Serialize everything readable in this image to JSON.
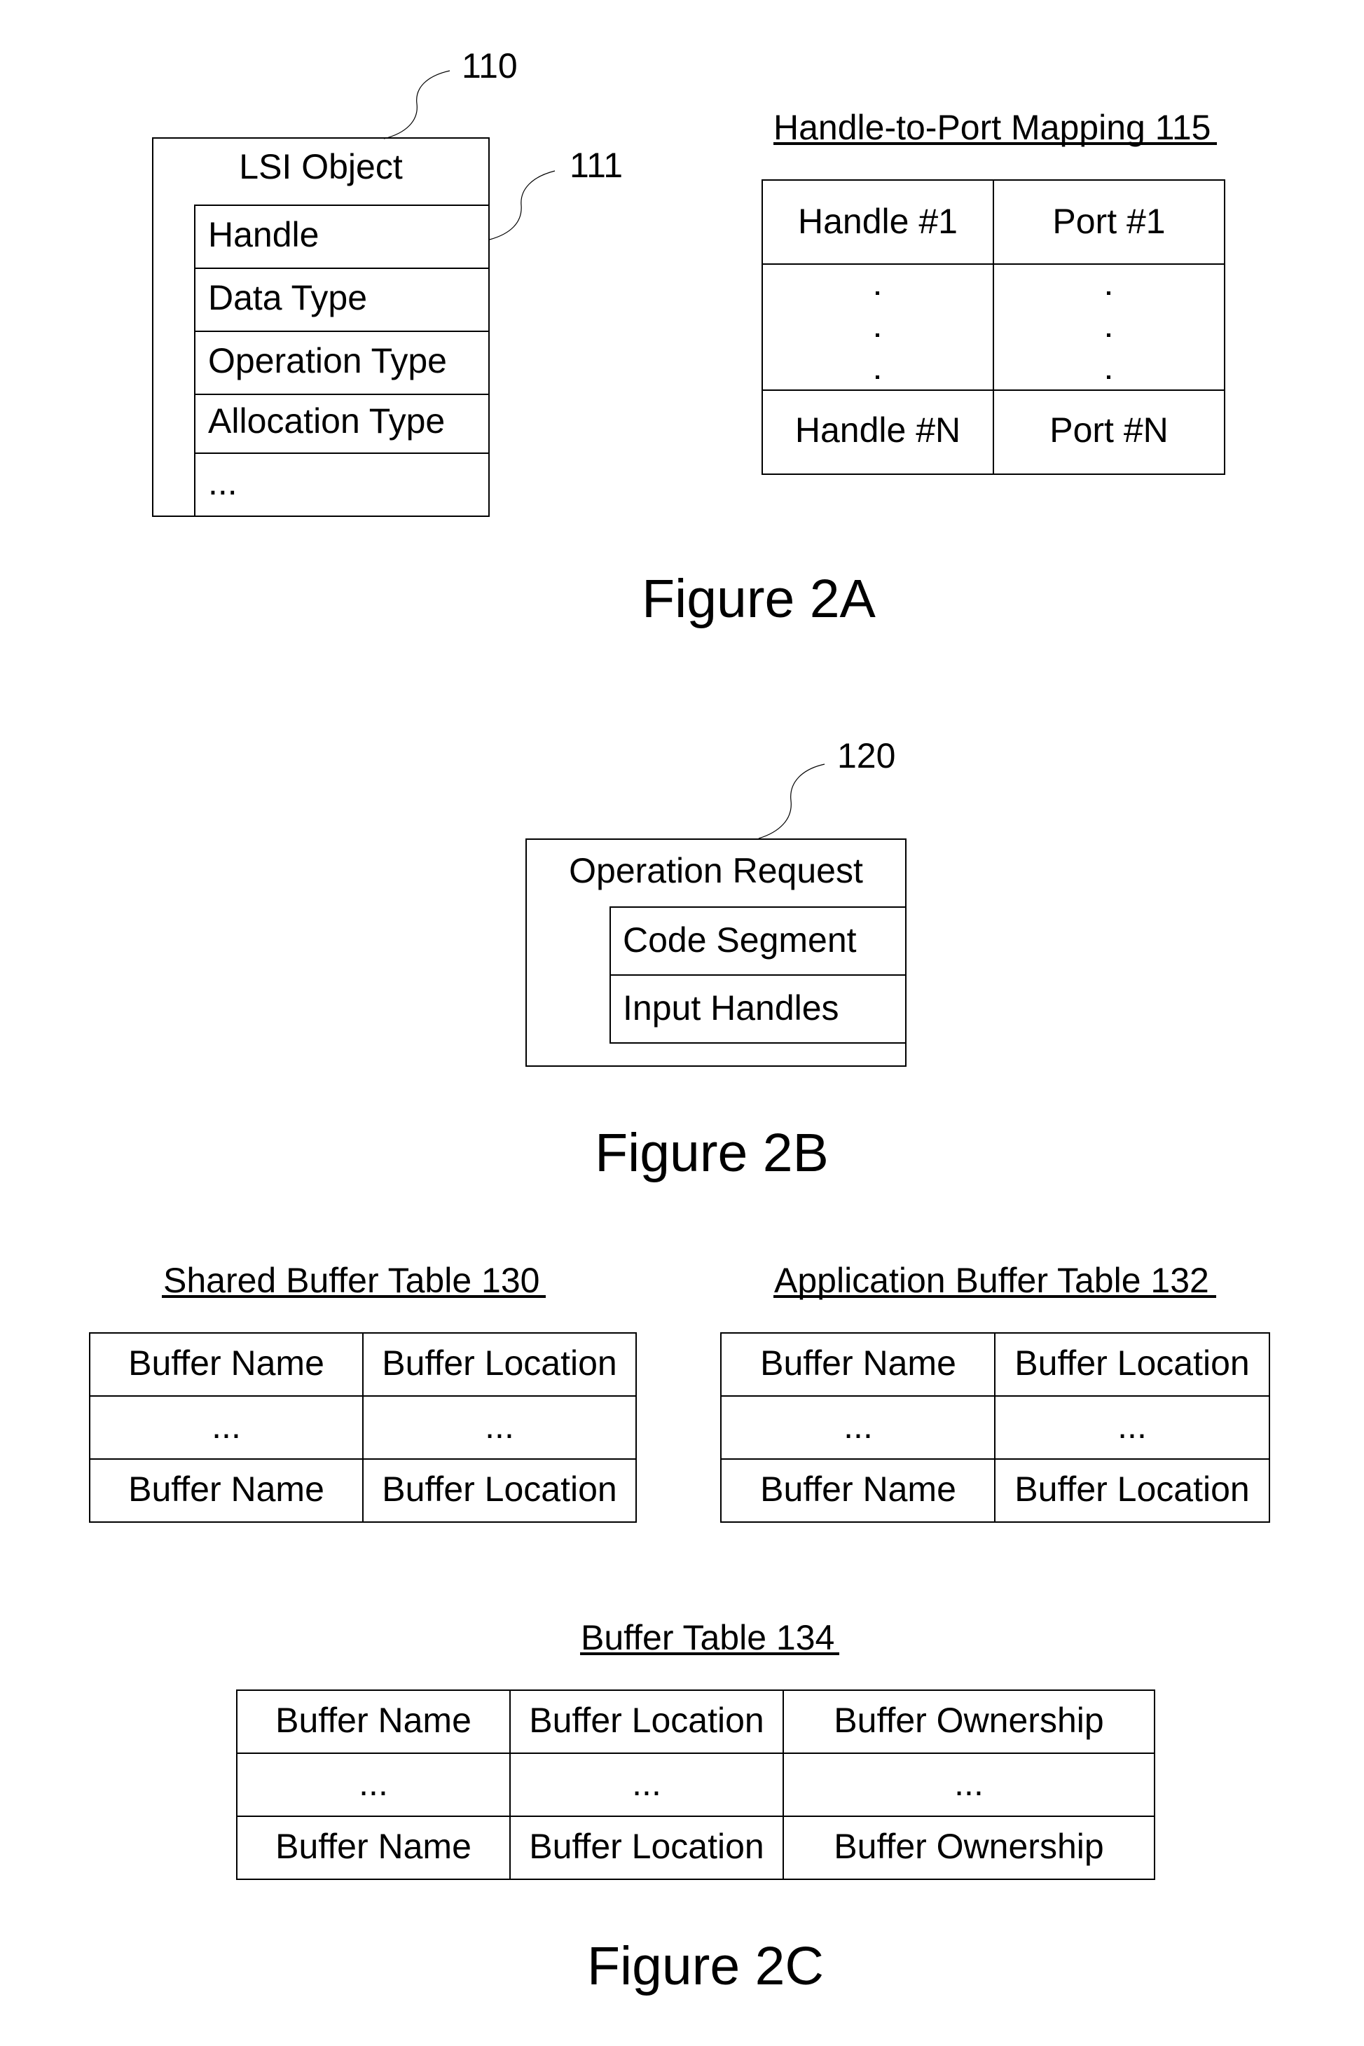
{
  "figure_2a": {
    "caption": "Figure 2A",
    "lsi_object": {
      "ref": "110",
      "title": "LSI Object",
      "fields_ref": "111",
      "fields": [
        "Handle",
        "Data Type",
        "Operation Type",
        "Allocation Type",
        "..."
      ]
    },
    "handle_to_port_mapping": {
      "title": "Handle-to-Port Mapping 115",
      "rows": [
        [
          "Handle #1",
          "Port #1"
        ],
        [
          "·",
          "·"
        ],
        [
          "Handle #N",
          "Port #N"
        ]
      ]
    }
  },
  "figure_2b": {
    "caption": "Figure 2B",
    "operation_request": {
      "ref": "120",
      "title": "Operation Request",
      "fields": [
        "Code Segment",
        "Input Handles"
      ]
    }
  },
  "figure_2c": {
    "caption": "Figure 2C",
    "shared_buffer_table": {
      "title": "Shared Buffer Table 130",
      "rows": [
        [
          "Buffer Name",
          "Buffer Location"
        ],
        [
          "...",
          "..."
        ],
        [
          "Buffer Name",
          "Buffer Location"
        ]
      ]
    },
    "application_buffer_table": {
      "title": "Application Buffer Table 132",
      "rows": [
        [
          "Buffer Name",
          "Buffer Location"
        ],
        [
          "...",
          "..."
        ],
        [
          "Buffer Name",
          "Buffer Location"
        ]
      ]
    },
    "buffer_table": {
      "title": "Buffer Table 134",
      "rows": [
        [
          "Buffer Name",
          "Buffer Location",
          "Buffer Ownership"
        ],
        [
          "...",
          "...",
          "..."
        ],
        [
          "Buffer Name",
          "Buffer Location",
          "Buffer Ownership"
        ]
      ]
    }
  }
}
